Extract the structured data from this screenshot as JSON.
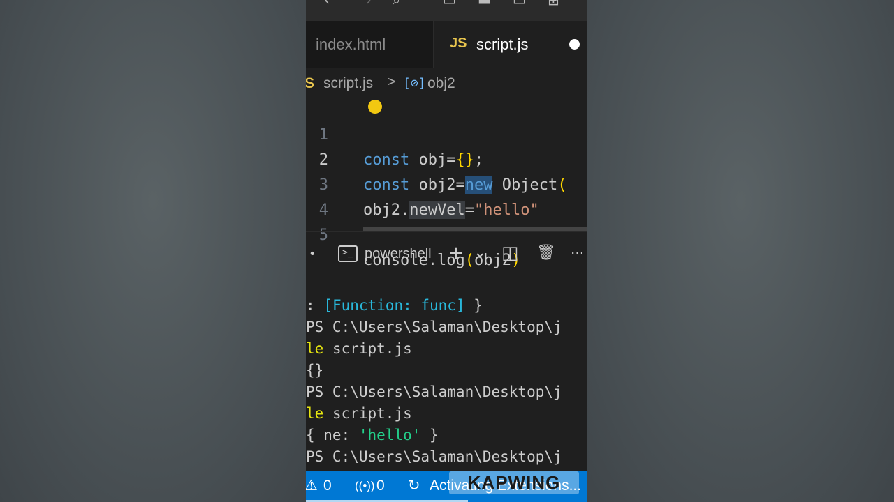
{
  "editor": {
    "tabs": [
      {
        "label": "index.html"
      },
      {
        "badge": "JS",
        "label": "script.js"
      }
    ],
    "breadcrumb": {
      "lang_badge": "S",
      "file": "script.js",
      "separator": ">",
      "symbol_icon": "[⊘]",
      "symbol": "obj2"
    },
    "lines": [
      {
        "n": "1",
        "a": "const",
        "b": " obj=",
        "c": "{}",
        "d": ";"
      },
      {
        "n": "2",
        "a": "const",
        "b": " obj2=",
        "c": "new",
        "d": " Object",
        "e": "("
      },
      {
        "n": "3",
        "a": "obj2.",
        "b": "newVel",
        "c": "=",
        "d": "\"hello\""
      },
      {
        "n": "4"
      },
      {
        "n": "5",
        "a": "console.log",
        "b": "(",
        "c": "obj2",
        "d": ")"
      }
    ]
  },
  "terminal": {
    "dot": "•",
    "shell_name": "powershell",
    "shell_icon": ">_",
    "icons": {
      "add": "+",
      "dropdown": "⌄",
      "split": "◫",
      "trash": "🗑",
      "more": "···"
    },
    "lines": [
      {
        "a": ": ",
        "b": "[Function: func]",
        "c": " }"
      },
      {
        "a": "PS C:\\Users\\Salaman\\Desktop\\j"
      },
      {
        "a": "le",
        "b": " script.js"
      },
      {
        "a": "{}"
      },
      {
        "a": "PS C:\\Users\\Salaman\\Desktop\\j"
      },
      {
        "a": "le",
        "b": " script.js"
      },
      {
        "a": "{ ne: ",
        "b": "'hello'",
        "c": " }"
      },
      {
        "a": "PS C:\\Users\\Salaman\\Desktop\\j"
      }
    ]
  },
  "statusbar": {
    "warning_icon": "⚠",
    "warnings": "0",
    "broadcast_icon": "((•))",
    "ports": "0",
    "sync_icon": "↻",
    "activity": "Activating Extensions..."
  },
  "watermark": "KAPWING",
  "colors": {
    "accent": "#0078d4",
    "keyword": "#569cd6",
    "string": "#ce9178",
    "js_badge": "#e8c54e"
  }
}
